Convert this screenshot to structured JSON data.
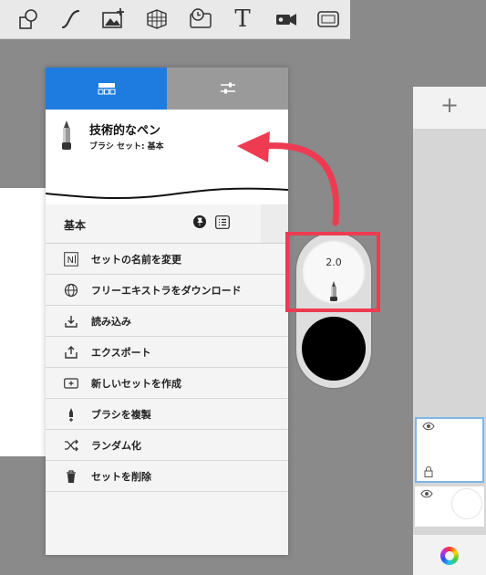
{
  "toolbar": {
    "tools": [
      "shape-tool",
      "curve-tool",
      "image-add-tool",
      "perspective-tool",
      "time-lapse-tool",
      "text-tool",
      "video-tool",
      "fullscreen-tool"
    ],
    "text_tool_glyph": "T"
  },
  "brush_panel": {
    "tabs": [
      {
        "name": "brush-library-tab",
        "active": true
      },
      {
        "name": "brush-properties-tab",
        "active": false
      }
    ],
    "brush_name": "技術的なペン",
    "brush_set_label": "ブラシ セット: 基本",
    "set_name": "基本",
    "menu": [
      {
        "icon": "rename-icon",
        "label": "セットの名前を変更"
      },
      {
        "icon": "globe-icon",
        "label": "フリーエキストラをダウンロード"
      },
      {
        "icon": "import-icon",
        "label": "読み込み"
      },
      {
        "icon": "export-icon",
        "label": "エクスポート"
      },
      {
        "icon": "new-set-icon",
        "label": "新しいセットを作成"
      },
      {
        "icon": "duplicate-brush-icon",
        "label": "ブラシを複製"
      },
      {
        "icon": "shuffle-icon",
        "label": "ランダム化"
      },
      {
        "icon": "trash-icon",
        "label": "セットを削除"
      }
    ],
    "rename_icon_glyph": "N"
  },
  "brush_widget": {
    "size_value": "2.0",
    "color": "#000000"
  },
  "layers": {
    "add_label": "+"
  },
  "colors": {
    "accent": "#1e7be0",
    "highlight": "#ee3b52"
  }
}
